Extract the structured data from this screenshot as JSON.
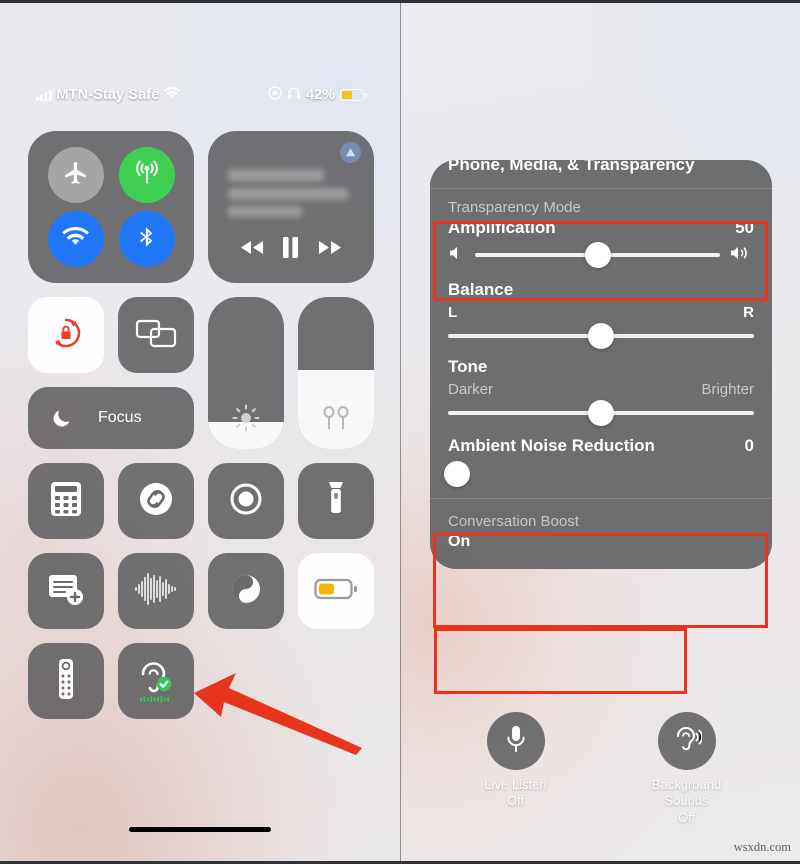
{
  "left_panel": {
    "status_bar": {
      "signal_icon": "cellular-bars-icon",
      "carrier": "MTN-Stay Safe",
      "wifi_icon": "wifi-icon",
      "record_icon": "screen-record-icon",
      "headphones_icon": "headphones-icon",
      "battery_percent": "42%",
      "battery_icon": "battery-low-power-icon"
    },
    "connectivity": {
      "name": "connectivity-tile",
      "buttons": [
        {
          "name": "airplane-mode-button",
          "icon": "airplane-icon",
          "state": "off",
          "color": "#a6a5a6"
        },
        {
          "name": "cellular-data-button",
          "icon": "cellular-antenna-icon",
          "state": "on",
          "color": "#3ecf53"
        },
        {
          "name": "wifi-button",
          "icon": "wifi-icon",
          "state": "on",
          "color": "#2076f5"
        },
        {
          "name": "bluetooth-button",
          "icon": "bluetooth-icon",
          "state": "on",
          "color": "#2076f5"
        }
      ]
    },
    "media": {
      "name": "now-playing-tile",
      "airplay_icon": "airplay-icon",
      "rewind_icon": "rewind-icon",
      "pause_icon": "pause-icon",
      "forward_icon": "fast-forward-icon",
      "track_title_blurred": true
    },
    "row2": {
      "rotation_lock": {
        "label": "rotation-lock",
        "icon": "rotation-lock-icon",
        "state": "on"
      },
      "screen_mirroring": {
        "label": "screen-mirroring",
        "icon": "screen-mirroring-icon",
        "state": "off"
      },
      "focus": {
        "label": "Focus",
        "icon": "moon-icon",
        "state": "off"
      },
      "brightness": {
        "label": "brightness-slider",
        "icon": "brightness-icon",
        "value": 18
      },
      "volume": {
        "label": "volume-slider",
        "icon": "airpods-icon",
        "value": 52
      }
    },
    "app_tiles": [
      {
        "name": "calculator-tile",
        "icon": "calculator-icon",
        "state": "off"
      },
      {
        "name": "shazam-tile",
        "icon": "shazam-icon",
        "state": "off"
      },
      {
        "name": "screen-record-tile",
        "icon": "screen-record-icon",
        "state": "off"
      },
      {
        "name": "flashlight-tile",
        "icon": "flashlight-icon",
        "state": "off"
      },
      {
        "name": "quick-note-tile",
        "icon": "note-add-icon",
        "state": "off"
      },
      {
        "name": "voice-memos-tile",
        "icon": "waveform-icon",
        "state": "off"
      },
      {
        "name": "dark-mode-tile",
        "icon": "dark-mode-icon",
        "state": "off"
      },
      {
        "name": "low-power-mode-tile",
        "icon": "battery-icon",
        "state": "on"
      },
      {
        "name": "apple-tv-remote-tile",
        "icon": "remote-icon",
        "state": "off"
      },
      {
        "name": "hearing-tile",
        "icon": "ear-hearing-icon",
        "state": "on",
        "badge": "green-check"
      }
    ],
    "annotation": {
      "arrow": "red-arrow-pointing-to-hearing-tile",
      "color": "#e8341c"
    }
  },
  "right_panel": {
    "card_title": "Phone, Media, & Transparency",
    "section_label": "Transparency Mode",
    "amplification": {
      "label": "Amplification",
      "value": "50",
      "percent": 50,
      "min_icon": "volume-low-icon",
      "max_icon": "volume-high-icon"
    },
    "balance": {
      "label": "Balance",
      "left_label": "L",
      "right_label": "R",
      "percent": 50
    },
    "tone": {
      "label": "Tone",
      "left_label": "Darker",
      "right_label": "Brighter",
      "percent": 50
    },
    "ambient_noise_reduction": {
      "label": "Ambient Noise Reduction",
      "value": "0",
      "percent": 0
    },
    "conversation_boost": {
      "label": "Conversation Boost",
      "value": "On"
    },
    "bottom_buttons": [
      {
        "name": "live-listen-button",
        "icon": "microphone-icon",
        "label": "Live Listen",
        "status": "Off"
      },
      {
        "name": "background-sounds-button",
        "icon": "ear-hearing-icon",
        "label": "Background\nSounds",
        "status": "Off"
      }
    ],
    "highlight_color": "#e8341c"
  },
  "watermark": "wsxdn.com"
}
